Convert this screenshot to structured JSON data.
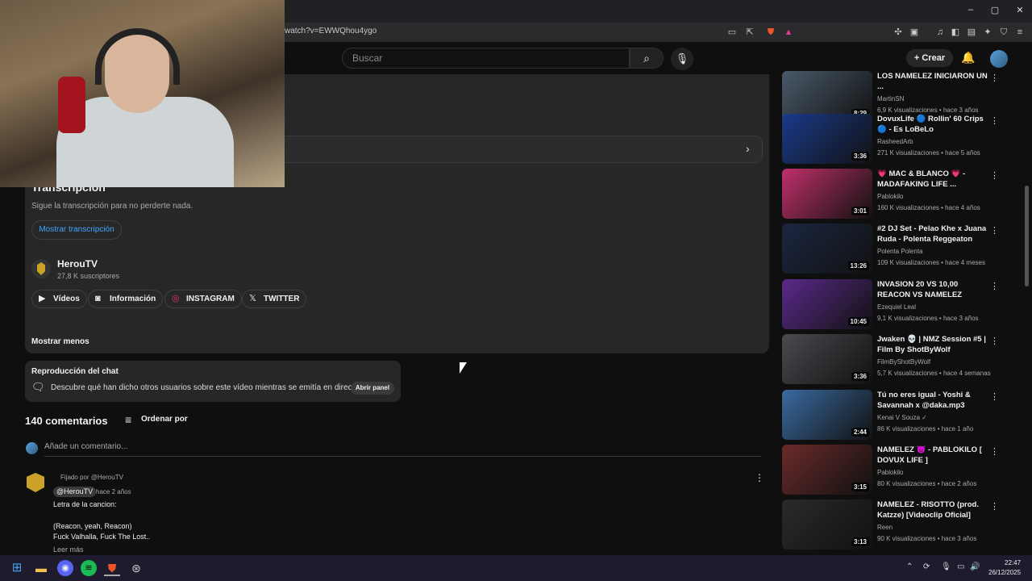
{
  "browser": {
    "url": "watch?v=EWWQhou4ygo",
    "window_controls": [
      "–",
      "▢",
      "✕"
    ]
  },
  "header": {
    "search_placeholder": "Buscar",
    "create_label": "Crear"
  },
  "description": {
    "transcript_heading": "Transcripción",
    "transcript_sub": "Sigue la transcripción para no perderte nada.",
    "show_transcript": "Mostrar transcripción",
    "channel_name": "HerouTV",
    "channel_subs": "27,8 K suscriptores",
    "links": [
      {
        "label": "Vídeos",
        "icon": "video-icon"
      },
      {
        "label": "Información",
        "icon": "info-icon"
      },
      {
        "label": "INSTAGRAM",
        "icon": "instagram-icon"
      },
      {
        "label": "TWITTER",
        "icon": "x-icon"
      }
    ],
    "show_less": "Mostrar menos"
  },
  "chat_replay": {
    "title": "Reproducción del chat",
    "text": "Descubre qué han dicho otros usuarios sobre este vídeo mientras se emitía en directo.",
    "button": "Abrir panel"
  },
  "comments": {
    "count": "140 comentarios",
    "sort": "Ordenar por",
    "add_placeholder": "Añade un comentario...",
    "pinned": {
      "pinned_by": "Fijado por @HerouTV",
      "author": "@HerouTV",
      "time": "hace 2 años",
      "lines": [
        "Letra de la cancion:",
        "",
        "(Reacon, yeah, Reacon)",
        "Fuck Valhalla, Fuck The Lost.."
      ],
      "read_more": "Leer más"
    }
  },
  "sidebar": {
    "items": [
      {
        "title": "LOS NAMELEZ INICIARON UN ...",
        "channel": "MartinSN",
        "meta": "6,9 K visualizaciones • hace 3 años",
        "duration": "8:29",
        "color": "#4a5a6a"
      },
      {
        "title": "DovuxLife 🔵 Rollin' 60 Crips 🔵 - Es LoBeLo",
        "channel": "RasheedArb",
        "meta": "271 K visualizaciones • hace 5 años",
        "duration": "3:36",
        "color": "#1a3a8a"
      },
      {
        "title": "💗 MAC & BLANCO 💗 - MADAFAKING LIFE ...",
        "channel": "Pablokilo",
        "meta": "160 K visualizaciones • hace 4 años",
        "duration": "3:01",
        "color": "#c0306a"
      },
      {
        "title": "#2 DJ Set - Pelao Khe x Juana Ruda - Polenta Reggeaton",
        "channel": "Polenta Polenta",
        "meta": "109 K visualizaciones • hace 4 meses",
        "duration": "13:26",
        "color": "#1b2640"
      },
      {
        "title": "INVASION 20 VS 10,00 REACON VS NAMELEZ",
        "channel": "Ezequiel Leal",
        "meta": "9,1 K visualizaciones • hace 3 años",
        "duration": "10:45",
        "color": "#5a2a8a"
      },
      {
        "title": "Jwaken 💀 | NMZ Session #5 | Film By ShotByWolf",
        "channel": "FilmByShotByWolf",
        "meta": "5,7 K visualizaciones • hace 4 semanas",
        "duration": "3:36",
        "color": "#4a4a50"
      },
      {
        "title": "Tú no eres igual - Yoshi & Savannah x @daka.mp3",
        "channel": "Kenai V Souza ✓",
        "meta": "86 K visualizaciones • hace 1 año",
        "duration": "2:44",
        "color": "#3a6aa0"
      },
      {
        "title": "NAMELEZ 👿 - PABLOKILO [ DOVUX LIFE ]",
        "channel": "Pablokilo",
        "meta": "80 K visualizaciones • hace 2 años",
        "duration": "3:15",
        "color": "#6a2a2a"
      },
      {
        "title": "NAMELEZ - RISOTTO (prod. Katzze) [Videoclip Oficial]",
        "channel": "Reen",
        "meta": "90 K visualizaciones • hace 3 años",
        "duration": "3:13",
        "color": "#2a2a2a"
      }
    ]
  },
  "taskbar": {
    "time": "22:47",
    "date": "26/12/2025"
  }
}
